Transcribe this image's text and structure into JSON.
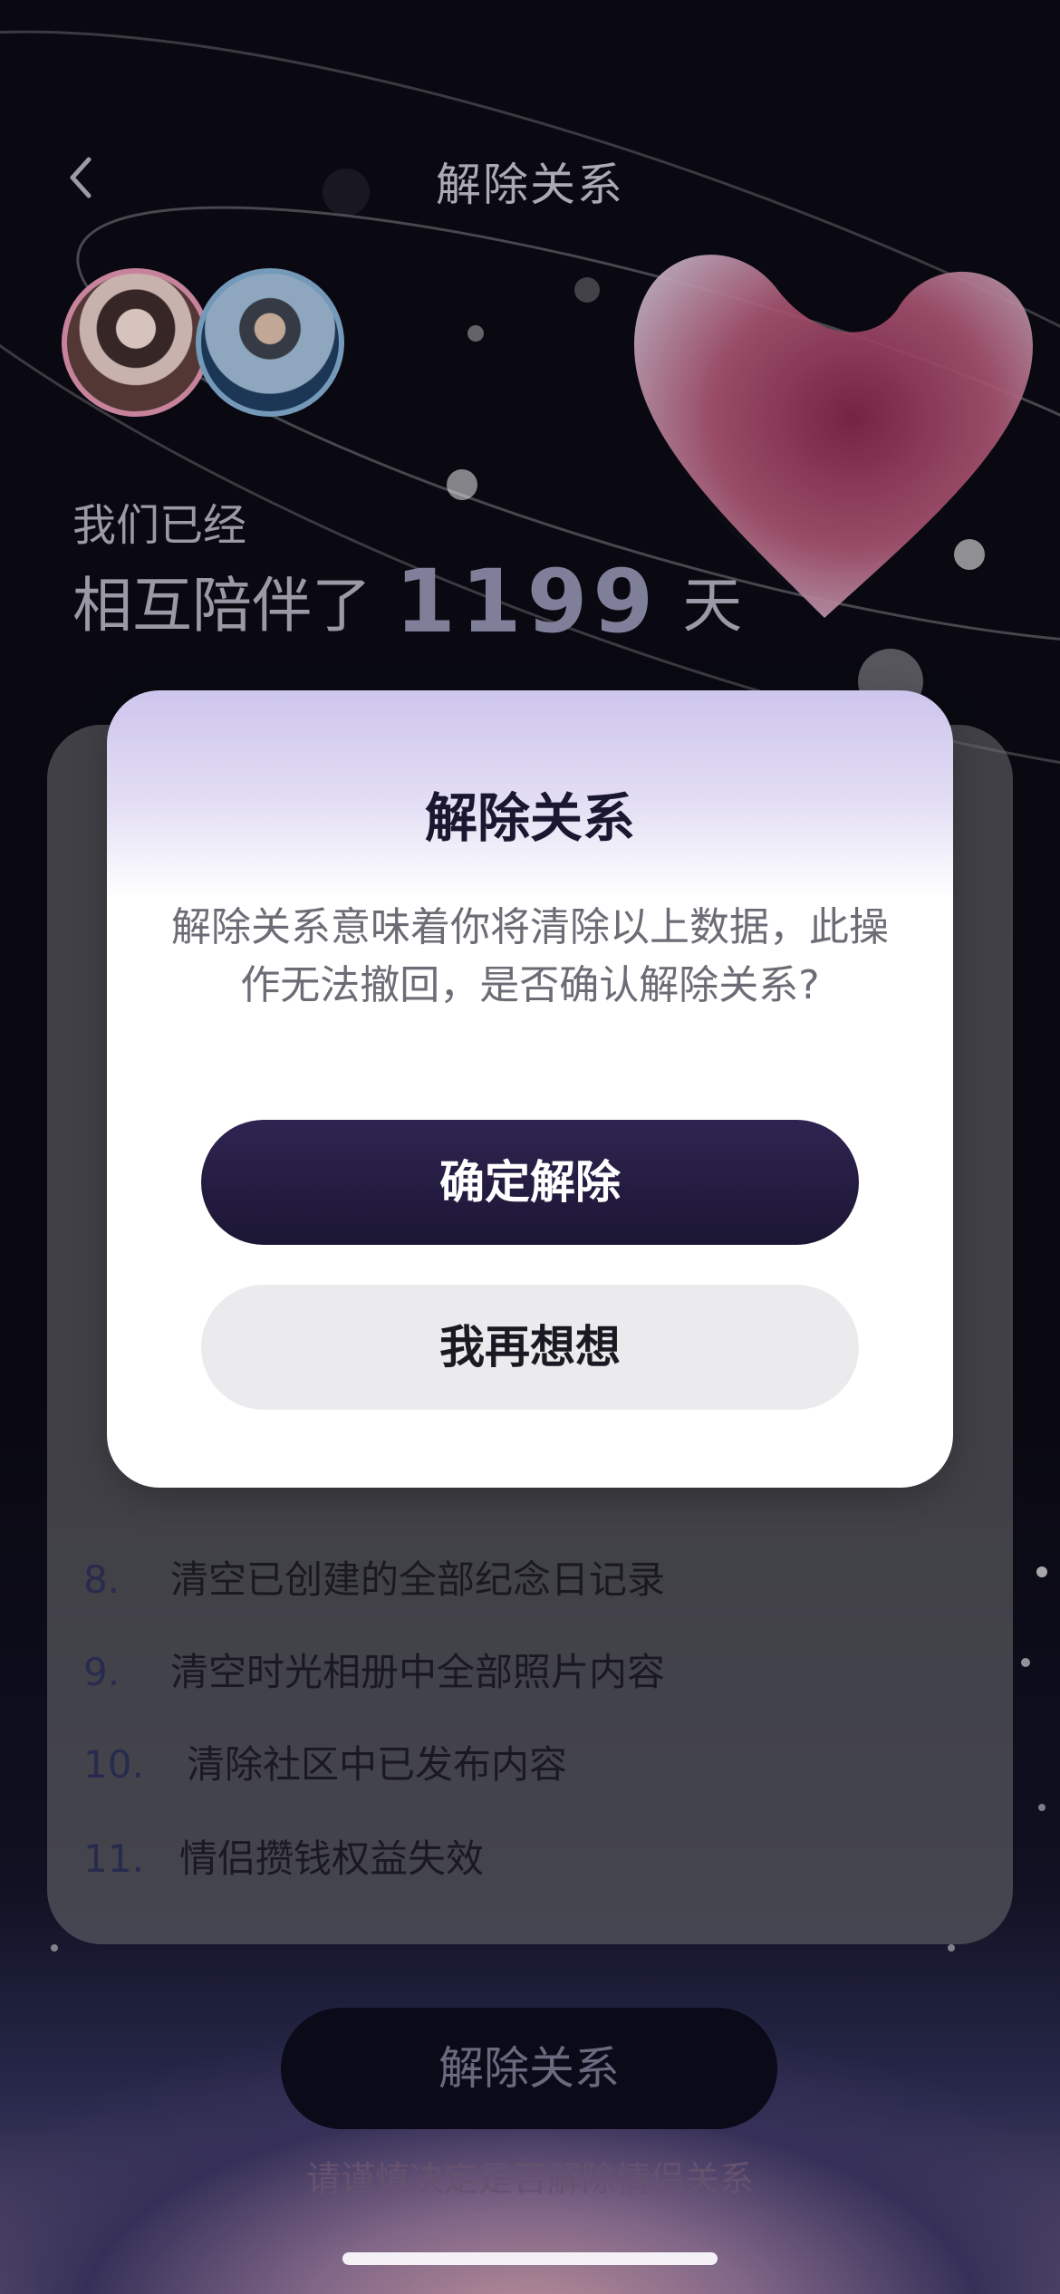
{
  "header": {
    "back_label": "",
    "title": "解除关系"
  },
  "couple": {
    "avatar_a_name": "",
    "avatar_b_name": "",
    "together_label": "我们已经",
    "days_prefix": "相互陪伴了",
    "days_count": "1199",
    "days_suffix": "天"
  },
  "clear_list": [
    {
      "index": "8.",
      "text": "清空已创建的全部纪念日记录"
    },
    {
      "index": "9.",
      "text": "清空时光相册中全部照片内容"
    },
    {
      "index": "10.",
      "text": "清除社区中已发布内容"
    },
    {
      "index": "11.",
      "text": "情侣攒钱权益失效"
    }
  ],
  "footer": {
    "unbind_button": "解除关系",
    "caution_text": "请谨慎决定是否解除情侣关系"
  },
  "dialog": {
    "title": "解除关系",
    "message_line1": "解除关系意味着你将清除以上数据，此操",
    "message_line2": "作无法撤回，是否确认解除关系?",
    "confirm_button": "确定解除",
    "cancel_button": "我再想想"
  },
  "colors": {
    "accent_dark": "#1c1634",
    "dialog_header_tint": "#cdc5ec",
    "heart_pink": "#c8486f"
  },
  "icons": {
    "back": "chevron-left-icon",
    "heart": "heart-icon"
  }
}
